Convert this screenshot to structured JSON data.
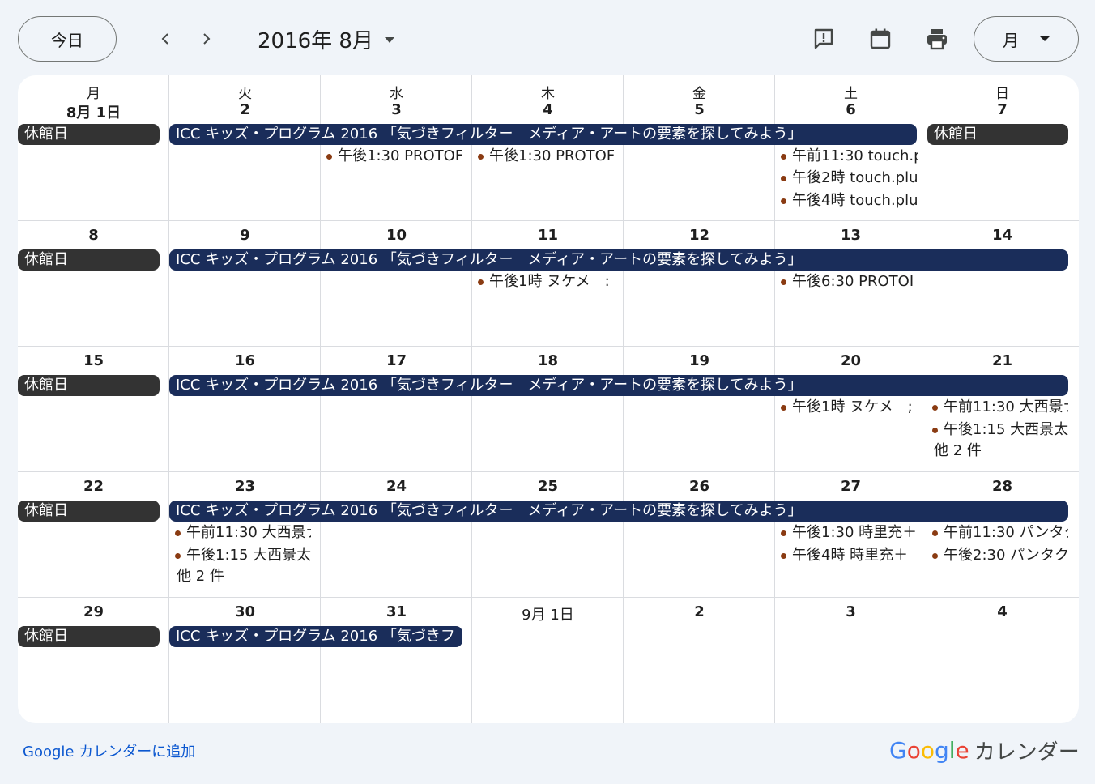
{
  "toolbar": {
    "today_label": "今日",
    "month_title": "2016年 8月",
    "view_label": "月",
    "icons": [
      "prev-chevron",
      "next-chevron",
      "feedback-icon",
      "calendar-icon",
      "print-icon"
    ]
  },
  "weekdays": [
    "月",
    "火",
    "水",
    "木",
    "金",
    "土",
    "日"
  ],
  "weeks": [
    {
      "days": [
        "8月 1日",
        "2",
        "3",
        "4",
        "5",
        "6",
        "7"
      ],
      "closed": [
        "休館日",
        "休館日"
      ],
      "banner": "ICC キッズ・プログラム 2016 「気づきフィルター　メディア・アートの要素を探してみよう」",
      "events": [
        "午後1:30 PROTOF",
        "午後1:30 PROTOF",
        "午前11:30 touch.p",
        "午後2時 touch.plu",
        "午後4時 touch.plu"
      ]
    },
    {
      "days": [
        "8",
        "9",
        "10",
        "11",
        "12",
        "13",
        "14"
      ],
      "closed": [
        "休館日"
      ],
      "banner": "ICC キッズ・プログラム 2016 「気づきフィルター　メディア・アートの要素を探してみよう」",
      "events": [
        "午後1時 ヌケメ　:",
        "午後6:30 PROTOI"
      ]
    },
    {
      "days": [
        "15",
        "16",
        "17",
        "18",
        "19",
        "20",
        "21"
      ],
      "closed": [
        "休館日"
      ],
      "banner": "ICC キッズ・プログラム 2016 「気づきフィルター　メディア・アートの要素を探してみよう」",
      "events": [
        "午後1時 ヌケメ　;",
        "午前11:30 大西景ナ",
        "午後1:15 大西景太"
      ],
      "more": "他 2 件"
    },
    {
      "days": [
        "22",
        "23",
        "24",
        "25",
        "26",
        "27",
        "28"
      ],
      "closed": [
        "休館日"
      ],
      "banner": "ICC キッズ・プログラム 2016 「気づきフィルター　メディア・アートの要素を探してみよう」",
      "events": [
        "午前11:30 大西景ナ",
        "午後1:15 大西景太",
        "午後1:30 時里充＋",
        "午後4時 時里充＋",
        "午前11:30 パンタク",
        "午後2:30 パンタク"
      ],
      "more": "他 2 件"
    },
    {
      "days": [
        "29",
        "30",
        "31",
        "9月 1日",
        "2",
        "3",
        "4"
      ],
      "closed": [
        "休館日"
      ],
      "banner": "ICC キッズ・プログラム 2016 「気づきフ"
    }
  ],
  "footer": {
    "add_link": "Google カレンダーに追加",
    "brand_letters": [
      "G",
      "o",
      "o",
      "g",
      "l",
      "e"
    ],
    "brand_label": "カレンダー"
  },
  "colors": {
    "closed_chip": "#333333",
    "banner": "#1a2d5a",
    "event_dot": "#8a3b12",
    "link": "#0b57d0",
    "page_bg": "#f0f4f9"
  }
}
